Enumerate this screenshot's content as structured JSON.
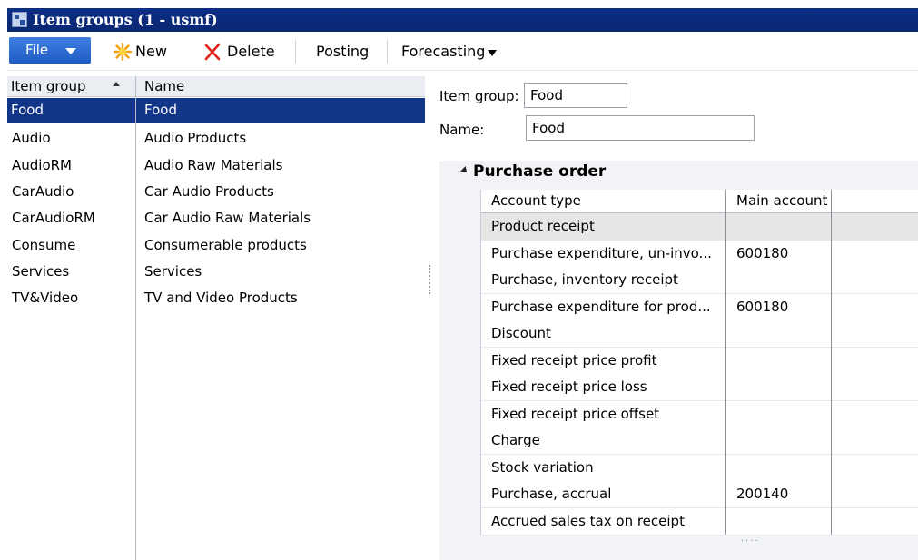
{
  "window": {
    "title": "Item groups (1 - usmf)"
  },
  "toolbar": {
    "file": "File",
    "new": "New",
    "delete": "Delete",
    "posting": "Posting",
    "forecasting": "Forecasting"
  },
  "grid": {
    "col_item_group": "Item group",
    "col_name": "Name",
    "rows": [
      {
        "group": "Food",
        "name": "Food"
      },
      {
        "group": "Audio",
        "name": "Audio Products"
      },
      {
        "group": "AudioRM",
        "name": "Audio Raw Materials"
      },
      {
        "group": "CarAudio",
        "name": "Car Audio Products"
      },
      {
        "group": "CarAudioRM",
        "name": "Car Audio Raw Materials"
      },
      {
        "group": "Consume",
        "name": "Consumerable products"
      },
      {
        "group": "Services",
        "name": "Services"
      },
      {
        "group": "TV&Video",
        "name": "TV and Video Products"
      }
    ],
    "selected_index": 0
  },
  "detail": {
    "item_group_label": "Item group:",
    "item_group_value": "Food",
    "name_label": "Name:",
    "name_value": "Food",
    "fasttab_title": "Purchase order",
    "col_account_type": "Account type",
    "col_main_account": "Main account",
    "rows": [
      {
        "type": "Product receipt",
        "account": ""
      },
      {
        "type": "Purchase expenditure, un-invo...",
        "account": "600180"
      },
      {
        "type": "Purchase, inventory receipt",
        "account": ""
      },
      {
        "type": "Purchase expenditure for prod...",
        "account": "600180"
      },
      {
        "type": "Discount",
        "account": ""
      },
      {
        "type": "Fixed receipt price profit",
        "account": ""
      },
      {
        "type": "Fixed receipt price loss",
        "account": ""
      },
      {
        "type": "Fixed receipt price offset",
        "account": ""
      },
      {
        "type": "Charge",
        "account": ""
      },
      {
        "type": "Stock variation",
        "account": ""
      },
      {
        "type": "Purchase, accrual",
        "account": "200140"
      },
      {
        "type": "Accrued sales tax on receipt",
        "account": ""
      }
    ],
    "more_indicator": "...."
  }
}
